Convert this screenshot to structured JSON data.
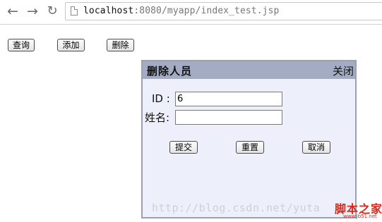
{
  "browser": {
    "back_icon": "arrow-left",
    "forward_icon": "arrow-right",
    "reload_icon": "reload",
    "url_host": "localhost",
    "url_path": ":8080/myapp/index_test.jsp"
  },
  "toolbar": {
    "query_label": "查询",
    "add_label": "添加",
    "delete_label": "删除"
  },
  "dialog": {
    "title": "删除人员",
    "close_label": "关闭",
    "id_label": "ID :",
    "id_value": "6",
    "name_label": "姓名:",
    "name_value": "",
    "submit_label": "提交",
    "reset_label": "重置",
    "cancel_label": "取消",
    "header_color": "#a3acc2",
    "body_color": "#edf0fa"
  },
  "watermark": {
    "text": "http://blog.csdn.net/yuta"
  },
  "logo": {
    "main": "脚本之家",
    "sub": "www.jb51.net"
  }
}
